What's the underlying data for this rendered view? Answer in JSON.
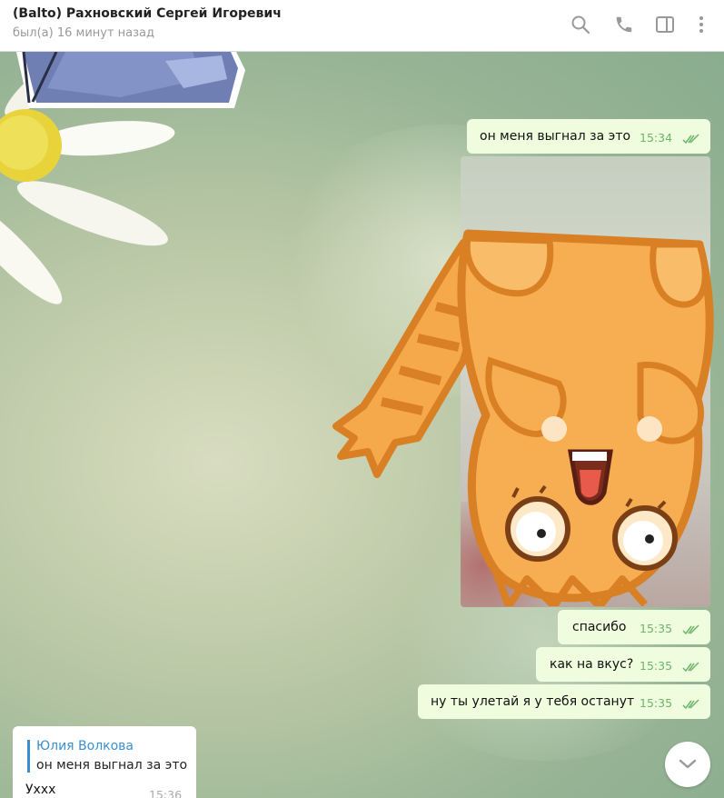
{
  "header": {
    "title": "(Balto) Рахновский Сергей Игоревич",
    "status": "был(а) 16 минут назад"
  },
  "messages": [
    {
      "text": "он меня выгнал за это",
      "time": "15:34"
    },
    {
      "text": "спасибо",
      "time": "15:35"
    },
    {
      "text": "как на вкус?",
      "time": "15:35"
    },
    {
      "text": "ну ты улетай я у тебя останут",
      "time": "15:35"
    }
  ],
  "incoming": {
    "reply_name": "Юлия Волкова",
    "reply_text": "он меня выгнал за это",
    "text": "Ухxx",
    "time": "15:36"
  },
  "colors": {
    "outgoing_bubble": "#effdde",
    "time_green": "#6cb46a",
    "reply_accent": "#3a8fd0"
  },
  "icons": [
    "search-icon",
    "phone-icon",
    "sidebar-toggle-icon",
    "more-menu-icon",
    "chevron-down-icon",
    "double-check-icon"
  ]
}
